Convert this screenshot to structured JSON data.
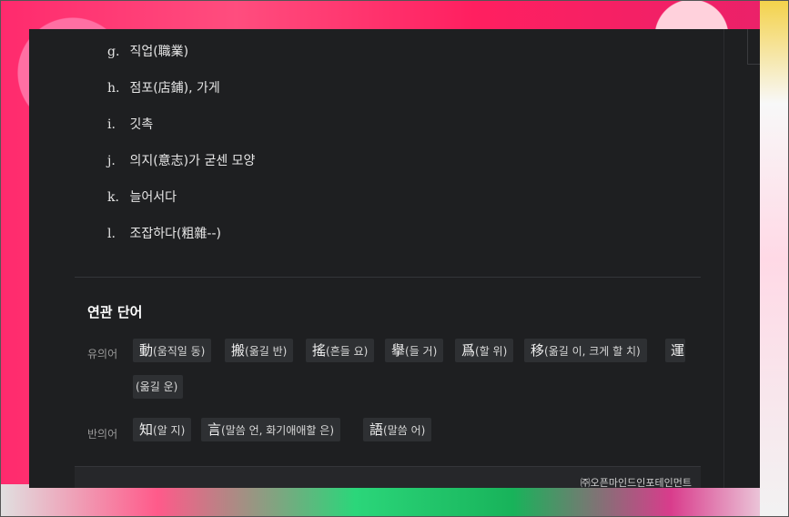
{
  "meanings": [
    {
      "letter": "g.",
      "text": "직업(職業)"
    },
    {
      "letter": "h.",
      "text": "점포(店鋪), 가게"
    },
    {
      "letter": "i.",
      "text": "깃촉"
    },
    {
      "letter": "j.",
      "text": "의지(意志)가 굳센 모양"
    },
    {
      "letter": "k.",
      "text": "늘어서다"
    },
    {
      "letter": "l.",
      "text": "조잡하다(粗雜--)"
    }
  ],
  "related": {
    "title": "연관 단어",
    "synonyms_label": "유의어",
    "antonyms_label": "반의어",
    "synonyms": [
      {
        "hanja": "動",
        "reading": "(움직일 동)"
      },
      {
        "hanja": "搬",
        "reading": "(옮길 반)"
      },
      {
        "hanja": "搖",
        "reading": "(흔들 요)"
      },
      {
        "hanja": "擧",
        "reading": "(들 거)"
      },
      {
        "hanja": "爲",
        "reading": "(할 위)"
      },
      {
        "hanja": "移",
        "reading": "(옮길 이, 크게 할 치)"
      },
      {
        "hanja": "運",
        "reading": "(옮길 운)"
      }
    ],
    "antonyms": [
      {
        "hanja": "知",
        "reading": "(알 지)"
      },
      {
        "hanja": "言",
        "reading": "(말씀 언, 화기애애할 은)"
      },
      {
        "hanja": "語",
        "reading": "(말씀 어)"
      }
    ]
  },
  "footer": {
    "copyright": "㈜오픈마인드인포테인먼트"
  }
}
